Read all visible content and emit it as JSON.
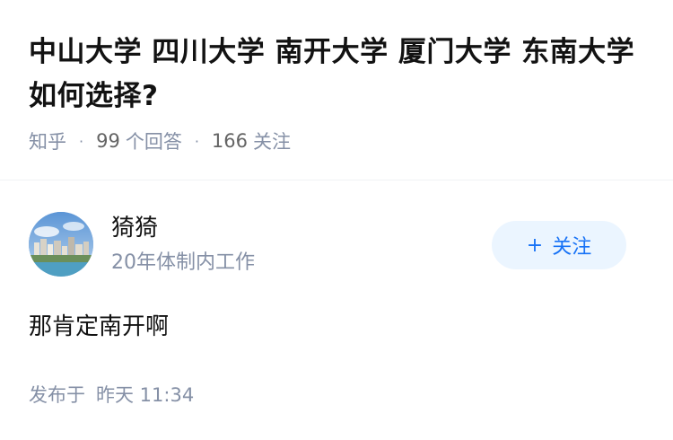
{
  "question": {
    "title": "中山大学 四川大学 南开大学 厦门大学 东南大学如何选择?",
    "source": "知乎",
    "answer_count": "99",
    "answer_label": "个回答",
    "follow_count": "166",
    "follow_label": "关注"
  },
  "answer": {
    "author": {
      "name": "猗猗",
      "bio": "20年体制内工作",
      "avatar_icon": "avatar-photo-icon"
    },
    "follow_button": {
      "icon": "plus-icon",
      "label": "关注"
    },
    "content": "那肯定南开啊",
    "published_prefix": "发布于",
    "published_time": "昨天 11:34"
  },
  "colors": {
    "accent": "#1772f6",
    "follow_bg": "#ebf5ff",
    "meta_text": "#8590a6"
  }
}
